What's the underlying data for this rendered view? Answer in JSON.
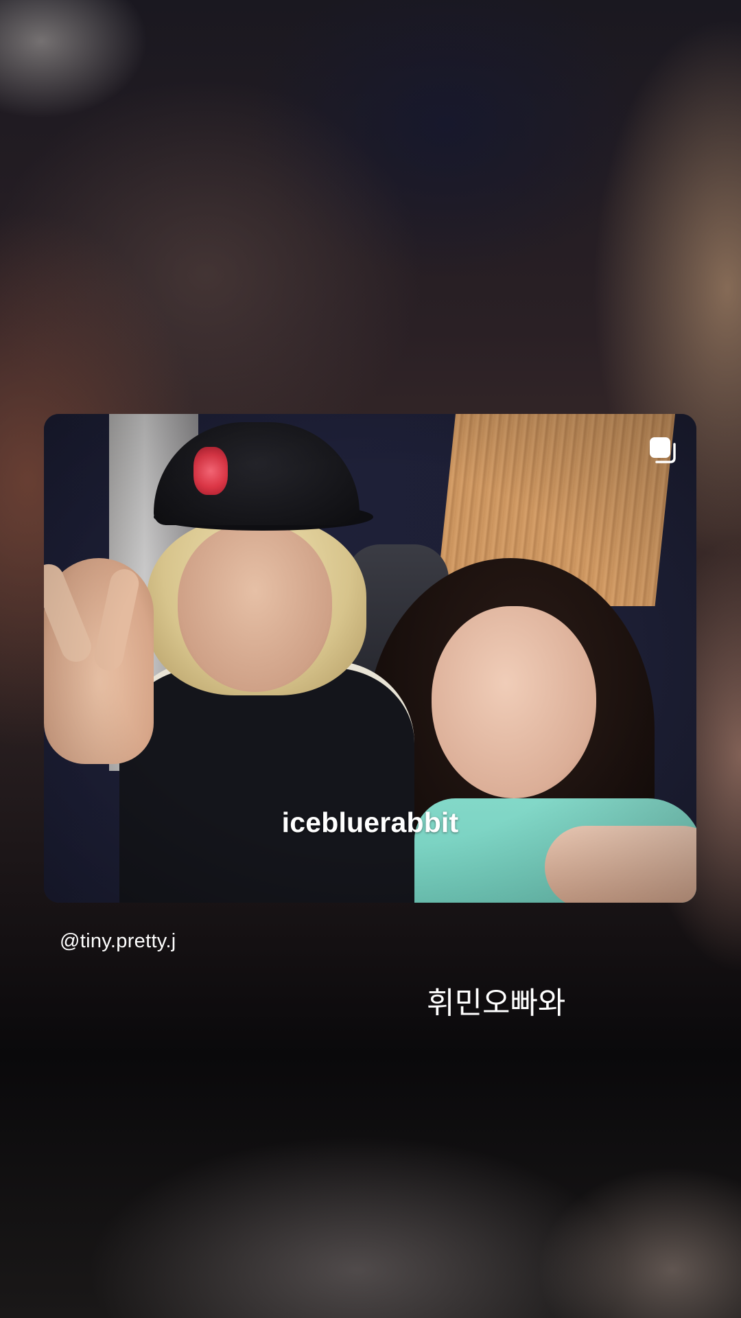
{
  "shared_post": {
    "username_overlay": "icebluerabbit",
    "icon": "multiple-photos-icon",
    "photo_description_icon": "post-photo"
  },
  "mention": "@tiny.pretty.j",
  "caption": "휘민오빠와"
}
